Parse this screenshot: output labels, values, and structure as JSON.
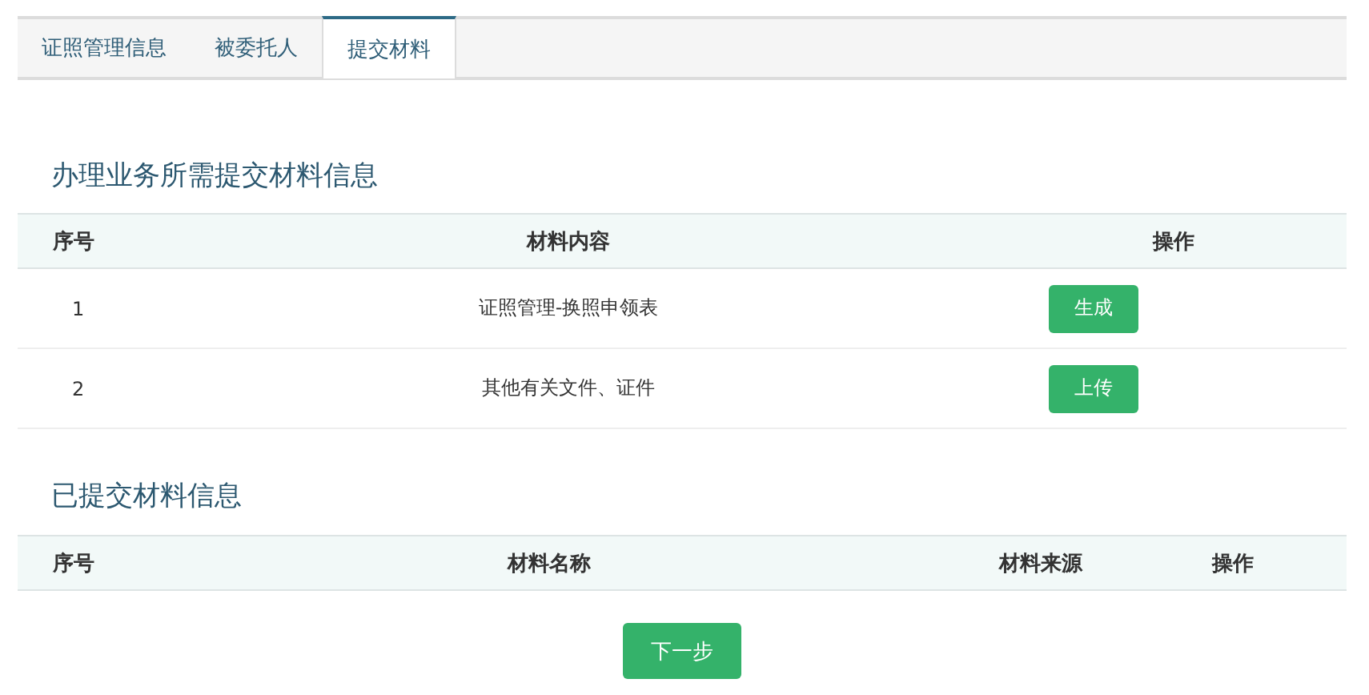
{
  "tabs": [
    {
      "label": "证照管理信息",
      "selected": false
    },
    {
      "label": "被委托人",
      "selected": false
    },
    {
      "label": "提交材料",
      "selected": true
    }
  ],
  "required_section": {
    "title": "办理业务所需提交材料信息",
    "columns": [
      "序号",
      "材料内容",
      "操作"
    ],
    "rows": [
      {
        "index": "1",
        "content": "证照管理-换照申领表",
        "action": "生成"
      },
      {
        "index": "2",
        "content": "其他有关文件、证件",
        "action": "上传"
      }
    ]
  },
  "submitted_section": {
    "title": "已提交材料信息",
    "columns": [
      "序号",
      "材料名称",
      "材料来源",
      "操作"
    ]
  },
  "next_button": "下一步"
}
